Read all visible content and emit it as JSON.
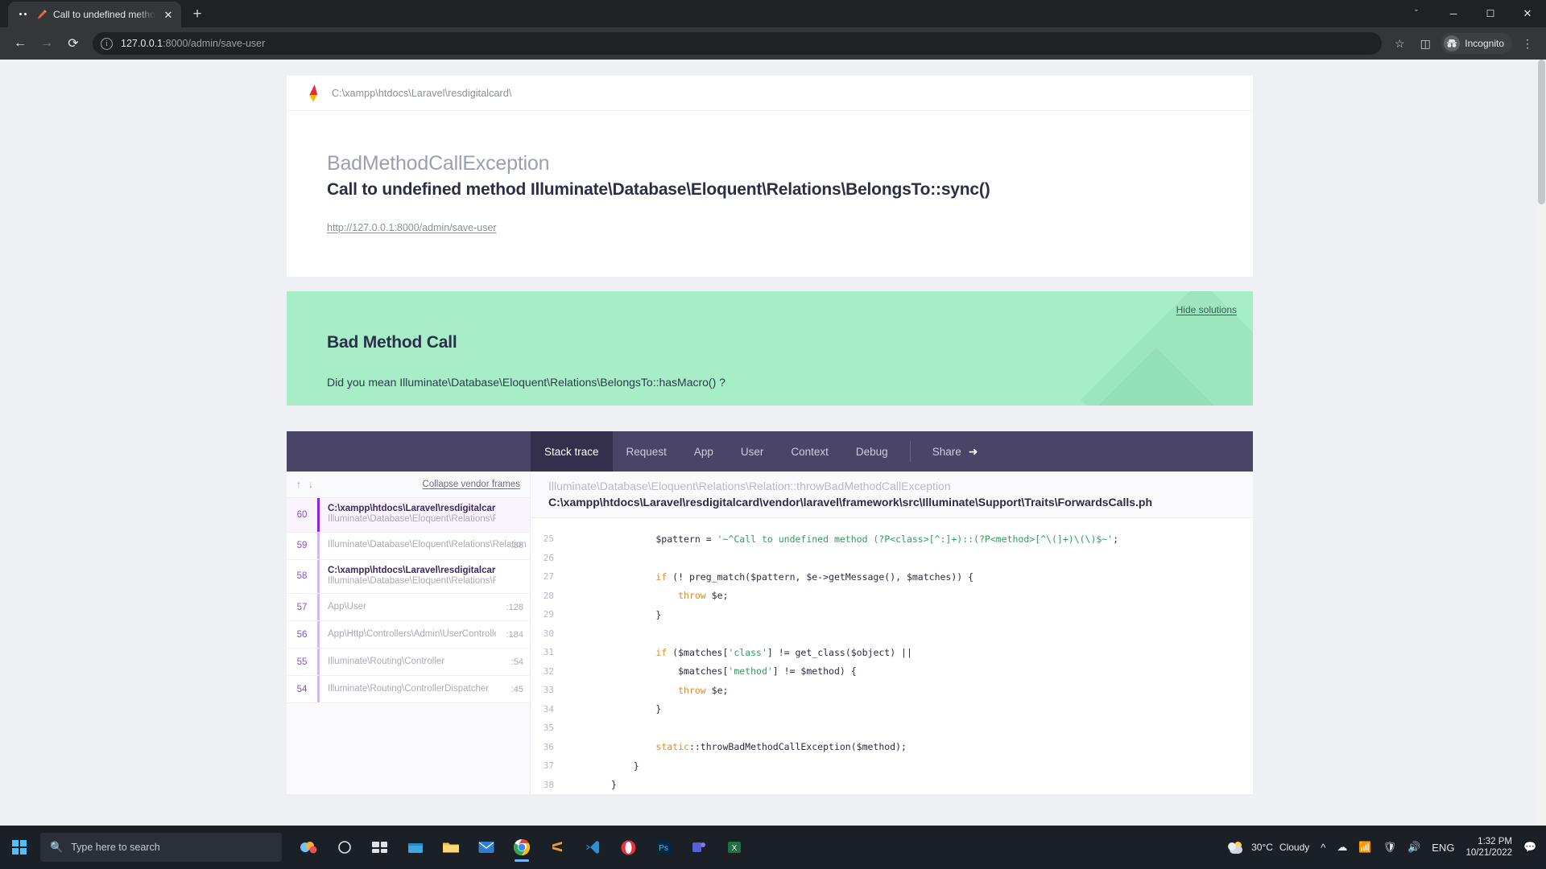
{
  "browser": {
    "tab": {
      "title": "Call to undefined method Illu",
      "favicon": "ghost-icon",
      "pen_icon": "pen-icon",
      "close_icon": "close-icon"
    },
    "new_tab_label": "+",
    "window_controls": {
      "chevron": "ˇ",
      "minimize": "─",
      "maximize": "☐",
      "close": "✕"
    },
    "nav": {
      "back": "←",
      "forward": "→",
      "reload": "⟳"
    },
    "omnibox": {
      "info_icon": "i",
      "url_host": "127.0.0.1",
      "url_rest": ":8000/admin/save-user"
    },
    "toolbar_right": {
      "bookmark": "☆",
      "sidepanel": "◫",
      "incognito_label": "Incognito",
      "menu": "⋮"
    }
  },
  "page": {
    "filepath": "C:\\xampp\\htdocs\\Laravel\\resdigitalcard\\",
    "exception_class": "BadMethodCallException",
    "exception_message": "Call to undefined method Illuminate\\Database\\Eloquent\\Relations\\BelongsTo::sync()",
    "request_url": "http://127.0.0.1:8000/admin/save-user",
    "solution": {
      "hide_label": "Hide solutions",
      "title": "Bad Method Call",
      "text": "Did you mean Illuminate\\Database\\Eloquent\\Relations\\BelongsTo::hasMacro() ?"
    },
    "tabs": [
      {
        "label": "Stack trace",
        "active": true
      },
      {
        "label": "Request",
        "active": false
      },
      {
        "label": "App",
        "active": false
      },
      {
        "label": "User",
        "active": false
      },
      {
        "label": "Context",
        "active": false
      },
      {
        "label": "Debug",
        "active": false
      }
    ],
    "share_label": "Share",
    "frames_header": {
      "up_arrow": "↑",
      "down_arrow": "↓",
      "collapse_label": "Collapse vendor frames"
    },
    "frames": [
      {
        "num": "60",
        "file": "C:\\xampp\\htdocs\\Laravel\\resdigitalcard\\vendor\\lara",
        "class": "Illuminate\\Database\\Eloquent\\Relations\\Relation",
        "line": "",
        "selected": true,
        "has_file": true,
        "wrap": false
      },
      {
        "num": "59",
        "file": "",
        "class": "Illuminate\\Database\\Eloquent\\Relations\\Relation",
        "line": ":36",
        "selected": false,
        "has_file": false,
        "wrap": true
      },
      {
        "num": "58",
        "file": "C:\\xampp\\htdocs\\Laravel\\resdigitalcard\\vendor\\lara",
        "class": "Illuminate\\Database\\Eloquent\\Relations\\Relation",
        "line": "",
        "selected": false,
        "has_file": true,
        "wrap": false
      },
      {
        "num": "57",
        "file": "",
        "class": "App\\User",
        "line": ":128",
        "selected": false,
        "has_file": false,
        "wrap": false
      },
      {
        "num": "56",
        "file": "",
        "class": "App\\Http\\Controllers\\Admin\\UserController",
        "line": ":184",
        "selected": false,
        "has_file": false,
        "wrap": false
      },
      {
        "num": "55",
        "file": "",
        "class": "Illuminate\\Routing\\Controller",
        "line": ":54",
        "selected": false,
        "has_file": false,
        "wrap": false
      },
      {
        "num": "54",
        "file": "",
        "class": "Illuminate\\Routing\\ControllerDispatcher",
        "line": ":45",
        "selected": false,
        "has_file": false,
        "wrap": false
      }
    ],
    "code_header": {
      "class": "Illuminate\\Database\\Eloquent\\Relations\\Relation::throwBadMethodCallException",
      "file": "C:\\xampp\\htdocs\\Laravel\\resdigitalcard\\vendor\\laravel\\framework\\src\\Illuminate\\Support\\Traits\\ForwardsCalls.ph"
    },
    "code_lines": [
      {
        "n": "25",
        "text": "        $pattern = '~^Call to undefined method (?P<class>[^:]+)::(?P<method>[^\\(]+)\\(\\)$~';"
      },
      {
        "n": "26",
        "text": ""
      },
      {
        "n": "27",
        "text": "        if (! preg_match($pattern, $e->getMessage(), $matches)) {"
      },
      {
        "n": "28",
        "text": "            throw $e;"
      },
      {
        "n": "29",
        "text": "        }"
      },
      {
        "n": "30",
        "text": ""
      },
      {
        "n": "31",
        "text": "        if ($matches['class'] != get_class($object) ||"
      },
      {
        "n": "32",
        "text": "            $matches['method'] != $method) {"
      },
      {
        "n": "33",
        "text": "            throw $e;"
      },
      {
        "n": "34",
        "text": "        }"
      },
      {
        "n": "35",
        "text": ""
      },
      {
        "n": "36",
        "text": "        static::throwBadMethodCallException($method);"
      },
      {
        "n": "37",
        "text": "    }"
      },
      {
        "n": "38",
        "text": "}"
      }
    ]
  },
  "taskbar": {
    "search_placeholder": "Type here to search",
    "search_icon": "search-icon",
    "items": [
      {
        "name": "task-view-icon"
      },
      {
        "name": "widgets-icon"
      },
      {
        "name": "file-explorer-icon"
      },
      {
        "name": "mail-icon"
      },
      {
        "name": "chrome-icon"
      },
      {
        "name": "sublime-icon"
      },
      {
        "name": "vscode-icon"
      },
      {
        "name": "opera-icon"
      },
      {
        "name": "photoshop-icon"
      },
      {
        "name": "teams-icon"
      },
      {
        "name": "excel-icon"
      }
    ],
    "weather_temp": "30°C",
    "weather_desc": "Cloudy",
    "lang": "ENG",
    "time": "1:32 PM",
    "date": "10/21/2022",
    "tray_icons": [
      "chevron-up-icon",
      "onedrive-icon",
      "network-icon",
      "shield-icon",
      "volume-icon"
    ]
  },
  "colors": {
    "accent_purple": "#4a4566",
    "solution_green": "#a6edc8",
    "frame_purple": "#9220dd",
    "code_string_green": "#2e9e5b"
  }
}
